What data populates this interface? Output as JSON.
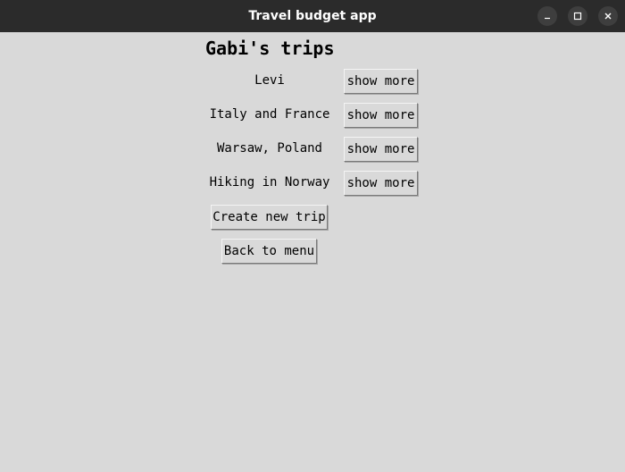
{
  "window": {
    "title": "Travel budget app",
    "controls": [
      "minimize-icon",
      "maximize-icon",
      "close-icon"
    ]
  },
  "main": {
    "heading": "Gabi's trips",
    "trips": [
      {
        "name": "Levi",
        "button": "show more"
      },
      {
        "name": "Italy and France",
        "button": "show more"
      },
      {
        "name": "Warsaw, Poland",
        "button": "show more"
      },
      {
        "name": "Hiking in Norway",
        "button": "show more"
      }
    ],
    "create_label": "Create new trip",
    "back_label": "Back to menu"
  },
  "colors": {
    "background": "#d9d9d9",
    "titlebar": "#2b2b2b",
    "titlebar_text": "#ffffff"
  }
}
